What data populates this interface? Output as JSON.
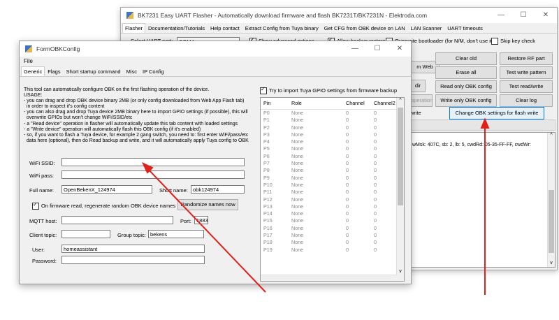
{
  "back_window": {
    "title": "BK7231 Easy UART Flasher - Automatically download firmware and flash BK7231T/BK7231N - Elektroda.com",
    "tabs": [
      "Flasher",
      "Documentation/Tutorials",
      "Help contact",
      "Extract Config from Tuya binary",
      "Get CFG from OBK device on LAN",
      "LAN Scanner",
      "UART timeouts"
    ],
    "uart_label": "Select UART port:",
    "uart_value": "COM4",
    "show_advanced": "Show advanced options",
    "allow_backup": "Allow backup restore",
    "overwrite_boot": "Overwrite bootloader (for N/M, don't use it)",
    "skip_key": "Skip key check",
    "buttons": {
      "clear_old": "Clear old",
      "restore_rf": "Restore RF part",
      "erase_all": "Erase all",
      "test_write_pattern": "Test write pattern",
      "read_only_obk": "Read only OBK config",
      "test_read_write": "Test read/write",
      "write_only_obk": "Write only OBK config",
      "clear_log": "Clear log",
      "change_obk": "Change OBK settings for flash write",
      "partial_web": "m Web",
      "partial_dir": "dir",
      "partial_operation": "operation",
      "partial_write": "write"
    },
    "log_text": "wMsk: 407C, sb: 2, lb: 5, cwdRd: 05-35-FF-FF, cwdWr:"
  },
  "front_window": {
    "title": "FormOBKConfig",
    "menu_file": "File",
    "tabs": [
      "Generic",
      "Flags",
      "Short startup command",
      "Misc",
      "IP Config"
    ],
    "description": "This tool can automatically configure OBK on the first flashing operation of the device.\nUSAGE:\n- you can drag and drop OBK device binary 2MB (or only config downloaded from Web App Flash tab)\n  in order to inspect it's config content\n- you can also drag and drop Tuya device 2MB binary here to import GPIO settings (if possible), this will\n  overwrite GPIOs but won't change WiFi/SSID/etc\n- a \"Read device\" operation in flasher will automatically update this tab content with loaded settings\n- a \"Write device\" operation will automatically flash this OBK config (if it's enabled)\n- so, if you want to flash a Tuya device, for example 2 gang switch, you need to: first enter WiFi/pass/etc\n  data here (optional), then do Read backup and write, and it will automatically apply Tuya config to OBK",
    "wifi_ssid_label": "WiFi SSID:",
    "wifi_ssid_value": "",
    "wifi_pass_label": "WiFi pass:",
    "wifi_pass_value": "",
    "full_name_label": "Full name:",
    "full_name_value": "OpenBekenX_124974",
    "short_name_label": "Short name:",
    "short_name_value": "obk124974",
    "regen_label": "On firmware read, regenerate random OBK device names",
    "randomize_button": "Randomize names now",
    "mqtt_host_label": "MQTT host:",
    "mqtt_host_value": "",
    "port_label": "Port:",
    "port_value": "1883",
    "client_topic_label": "Client topic:",
    "client_topic_value": "",
    "group_topic_label": "Group topic:",
    "group_topic_value": "bekens",
    "user_label": "User:",
    "user_value": "homeassistant",
    "password_label": "Password:",
    "password_value": "",
    "tuya_import_label": "Try to import Tuya GPIO settings from firmware backup",
    "grid_headers": [
      "Pin",
      "Role",
      "Channel",
      "Channel2"
    ],
    "grid_rows": [
      [
        "P0",
        "None",
        "0",
        "0"
      ],
      [
        "P1",
        "None",
        "0",
        "0"
      ],
      [
        "P2",
        "None",
        "0",
        "0"
      ],
      [
        "P3",
        "None",
        "0",
        "0"
      ],
      [
        "P4",
        "None",
        "0",
        "0"
      ],
      [
        "P5",
        "None",
        "0",
        "0"
      ],
      [
        "P6",
        "None",
        "0",
        "0"
      ],
      [
        "P7",
        "None",
        "0",
        "0"
      ],
      [
        "P8",
        "None",
        "0",
        "0"
      ],
      [
        "P9",
        "None",
        "0",
        "0"
      ],
      [
        "P10",
        "None",
        "0",
        "0"
      ],
      [
        "P11",
        "None",
        "0",
        "0"
      ],
      [
        "P12",
        "None",
        "0",
        "0"
      ],
      [
        "P13",
        "None",
        "0",
        "0"
      ],
      [
        "P14",
        "None",
        "0",
        "0"
      ],
      [
        "P15",
        "None",
        "0",
        "0"
      ],
      [
        "P16",
        "None",
        "0",
        "0"
      ],
      [
        "P17",
        "None",
        "0",
        "0"
      ],
      [
        "P18",
        "None",
        "0",
        "0"
      ],
      [
        "P19",
        "None",
        "0",
        "0"
      ]
    ]
  },
  "colors": {
    "arrow": "#e0201b",
    "accent": "#0078d7"
  }
}
